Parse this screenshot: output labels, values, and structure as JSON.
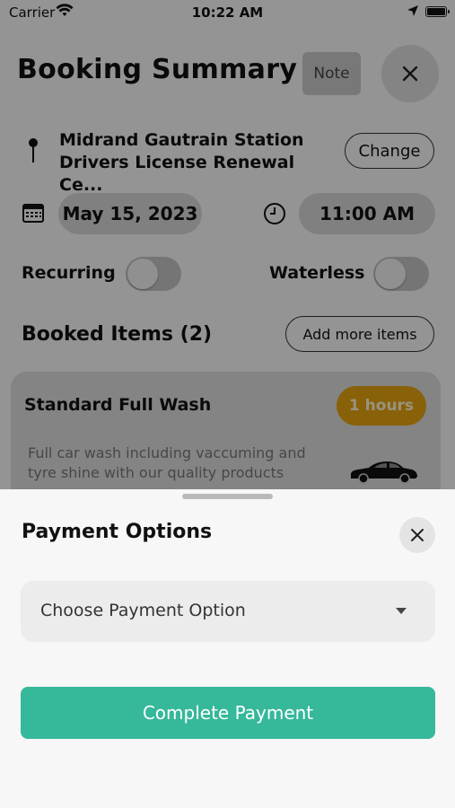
{
  "status_bar": {
    "carrier": "Carrier",
    "time": "10:22 AM",
    "icons": [
      "wifi-icon",
      "location-arrow-icon",
      "battery-icon"
    ]
  },
  "header": {
    "title": "Booking Summary",
    "note_label": "Note",
    "close_icon": "close-icon"
  },
  "location": {
    "line1": "Midrand Gautrain Station",
    "line2": "Drivers License Renewal Ce...",
    "change_label": "Change",
    "icon": "pin-icon"
  },
  "schedule": {
    "date": "May 15, 2023",
    "time": "11:00 AM",
    "date_icon": "calendar-icon",
    "time_icon": "clock-icon"
  },
  "options": {
    "recurring_label": "Recurring",
    "recurring_on": false,
    "waterless_label": "Waterless",
    "waterless_on": false
  },
  "booked_items": {
    "title": "Booked Items (2)",
    "add_label": "Add more items",
    "items": [
      {
        "name": "Standard Full Wash",
        "duration": "1 hours",
        "description": "Full car wash including vaccuming and tyre shine with our quality products",
        "icon": "car-icon"
      }
    ]
  },
  "payment_sheet": {
    "title": "Payment Options",
    "close_icon": "close-icon",
    "select_placeholder": "Choose Payment Option",
    "select_icon": "caret-down-icon",
    "submit_label": "Complete Payment"
  },
  "colors": {
    "accent": "#36b89a",
    "badge": "#e3a20f",
    "overlay": "rgba(0,0,0,0.40)"
  }
}
